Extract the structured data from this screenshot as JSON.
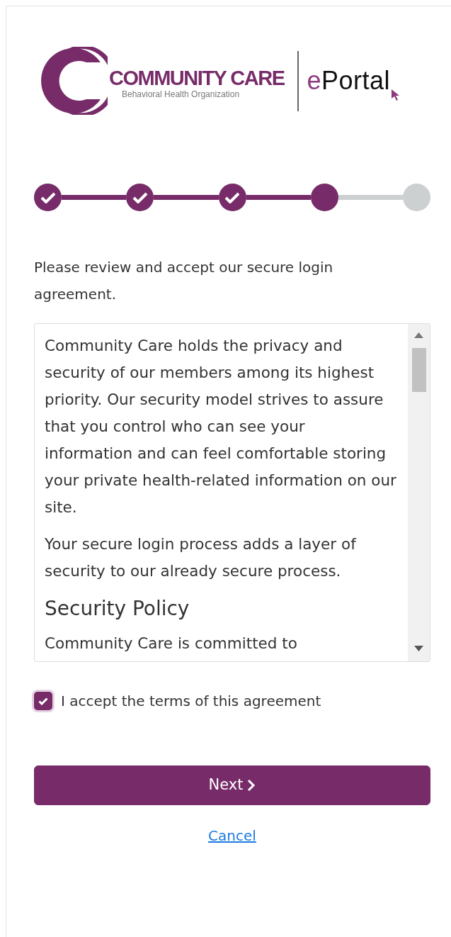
{
  "logo": {
    "name": "COMMUNITY CARE",
    "tagline": "Behavioral Health Organization",
    "product": "ePortal"
  },
  "steps": [
    {
      "completed": true
    },
    {
      "completed": true
    },
    {
      "completed": true
    },
    {
      "completed": false
    },
    {
      "completed": false
    }
  ],
  "intro": "Please review and accept our secure login agreement.",
  "agreement": {
    "blocks": [
      {
        "kind": "paragraph",
        "text": "Community Care holds the privacy and security of our members among its highest priority. Our security model strives to assure that you control who can see your information and can feel comfortable storing your private health-related information on our site."
      },
      {
        "kind": "paragraph",
        "text": "Your secure login process adds a layer of security to our already secure process."
      },
      {
        "kind": "heading",
        "text": "Security Policy"
      },
      {
        "kind": "paragraph",
        "text": "Community Care is committed to"
      }
    ]
  },
  "accept": {
    "label": "I accept the terms of this agreement",
    "checked": true
  },
  "next_button": {
    "label": "Next"
  },
  "cancel_link": {
    "label": "Cancel"
  }
}
